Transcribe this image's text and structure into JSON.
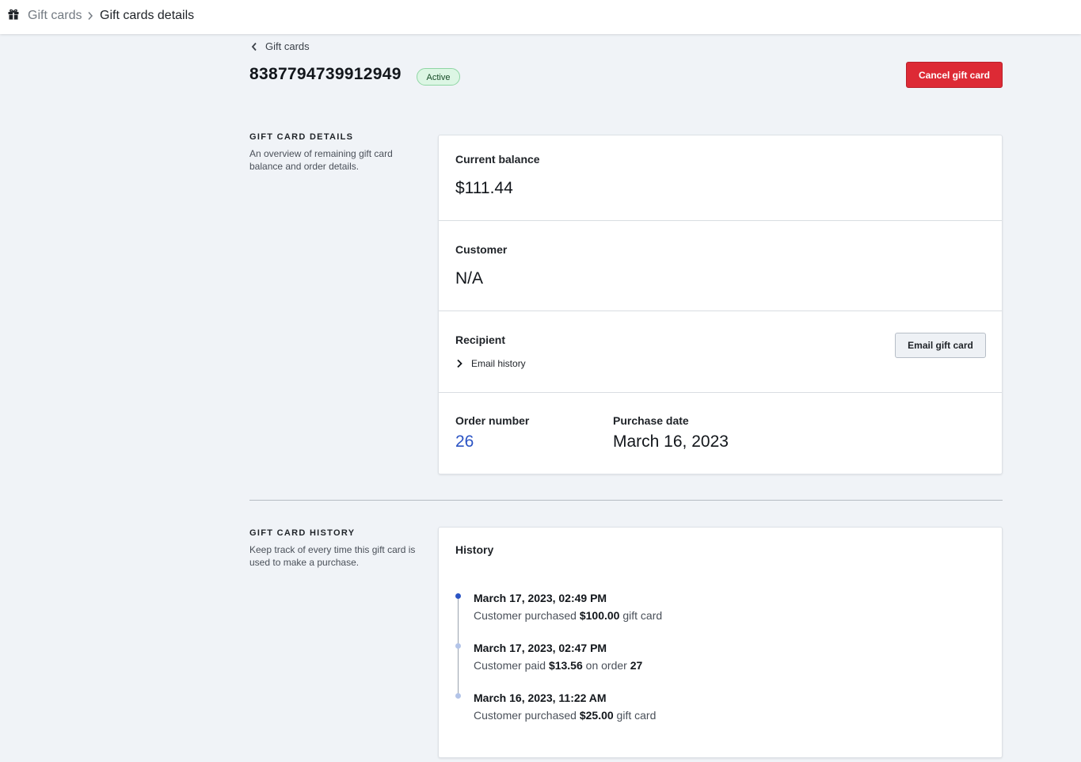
{
  "breadcrumb": {
    "root": "Gift cards",
    "current": "Gift cards details"
  },
  "header": {
    "back_label": "Gift cards",
    "card_code": "8387794739912949",
    "status": "Active",
    "cancel_label": "Cancel gift card"
  },
  "details_section": {
    "title": "GIFT CARD DETAILS",
    "description": "An overview of remaining gift card balance and order details."
  },
  "details": {
    "balance_label": "Current balance",
    "balance_value": "$111.44",
    "customer_label": "Customer",
    "customer_value": "N/A",
    "recipient_label": "Recipient",
    "email_history_label": "Email history",
    "email_button_label": "Email gift card",
    "order_label": "Order number",
    "order_value": "26",
    "purchase_label": "Purchase date",
    "purchase_value": "March 16, 2023"
  },
  "history_section": {
    "title": "GIFT CARD HISTORY",
    "description": "Keep track of every time this gift card is used to make a purchase."
  },
  "history": {
    "title": "History",
    "entries": [
      {
        "date": "March 17, 2023, 02:49 PM",
        "prefix": "Customer purchased ",
        "amount": "$100.00",
        "suffix": " gift card",
        "ref": ""
      },
      {
        "date": "March 17, 2023, 02:47 PM",
        "prefix": "Customer paid ",
        "amount": "$13.56",
        "suffix": " on order ",
        "ref": "27"
      },
      {
        "date": "March 16, 2023, 11:22 AM",
        "prefix": "Customer purchased ",
        "amount": "$25.00",
        "suffix": " gift card",
        "ref": ""
      }
    ]
  },
  "colors": {
    "accent_blue": "#2b54c4",
    "danger_red": "#dd2a35",
    "active_badge_bg": "#dcf6e4",
    "timeline_dot_current": "#2b54c4",
    "timeline_dot_past": "#b3c4e8"
  },
  "icons": {
    "breadcrumb_root": "gift-icon",
    "breadcrumb_separator": "chevron-right-icon",
    "back": "chevron-left-icon",
    "email_history_toggle": "chevron-right-icon"
  }
}
